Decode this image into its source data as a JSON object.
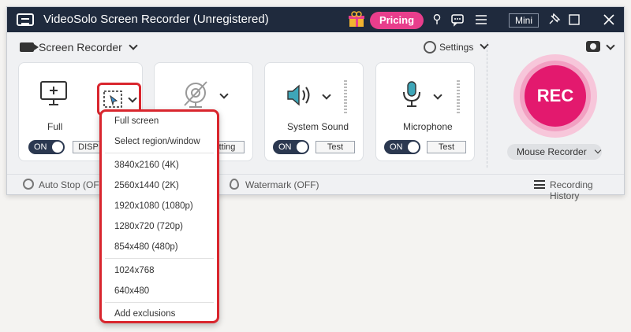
{
  "window": {
    "title": "VideoSolo Screen Recorder (Unregistered)",
    "pricing_label": "Pricing",
    "mini_label": "Mini"
  },
  "toolbar": {
    "mode_label": "Screen Recorder",
    "settings_label": "Settings"
  },
  "cards": {
    "display": {
      "label": "Full",
      "toggle_label": "ON",
      "button_label": "DISP"
    },
    "webcam": {
      "button_label": "tting"
    },
    "system_sound": {
      "label": "System Sound",
      "toggle_label": "ON",
      "button_label": "Test"
    },
    "microphone": {
      "label": "Microphone",
      "toggle_label": "ON",
      "button_label": "Test"
    }
  },
  "rec": {
    "label": "REC",
    "mouse_recorder_label": "Mouse Recorder"
  },
  "statusbar": {
    "auto_stop": "Auto Stop (OF",
    "watermark": "Watermark (OFF)",
    "history": "Recording History"
  },
  "dropdown": {
    "items": [
      "Full screen",
      "Select region/window",
      "3840x2160 (4K)",
      "2560x1440 (2K)",
      "1920x1080 (1080p)",
      "1280x720 (720p)",
      "854x480 (480p)",
      "1024x768",
      "640x480",
      "Add exclusions"
    ]
  },
  "colors": {
    "titlebar": "#1f2a3d",
    "accent": "#e3196e",
    "highlight": "#d9262e"
  }
}
